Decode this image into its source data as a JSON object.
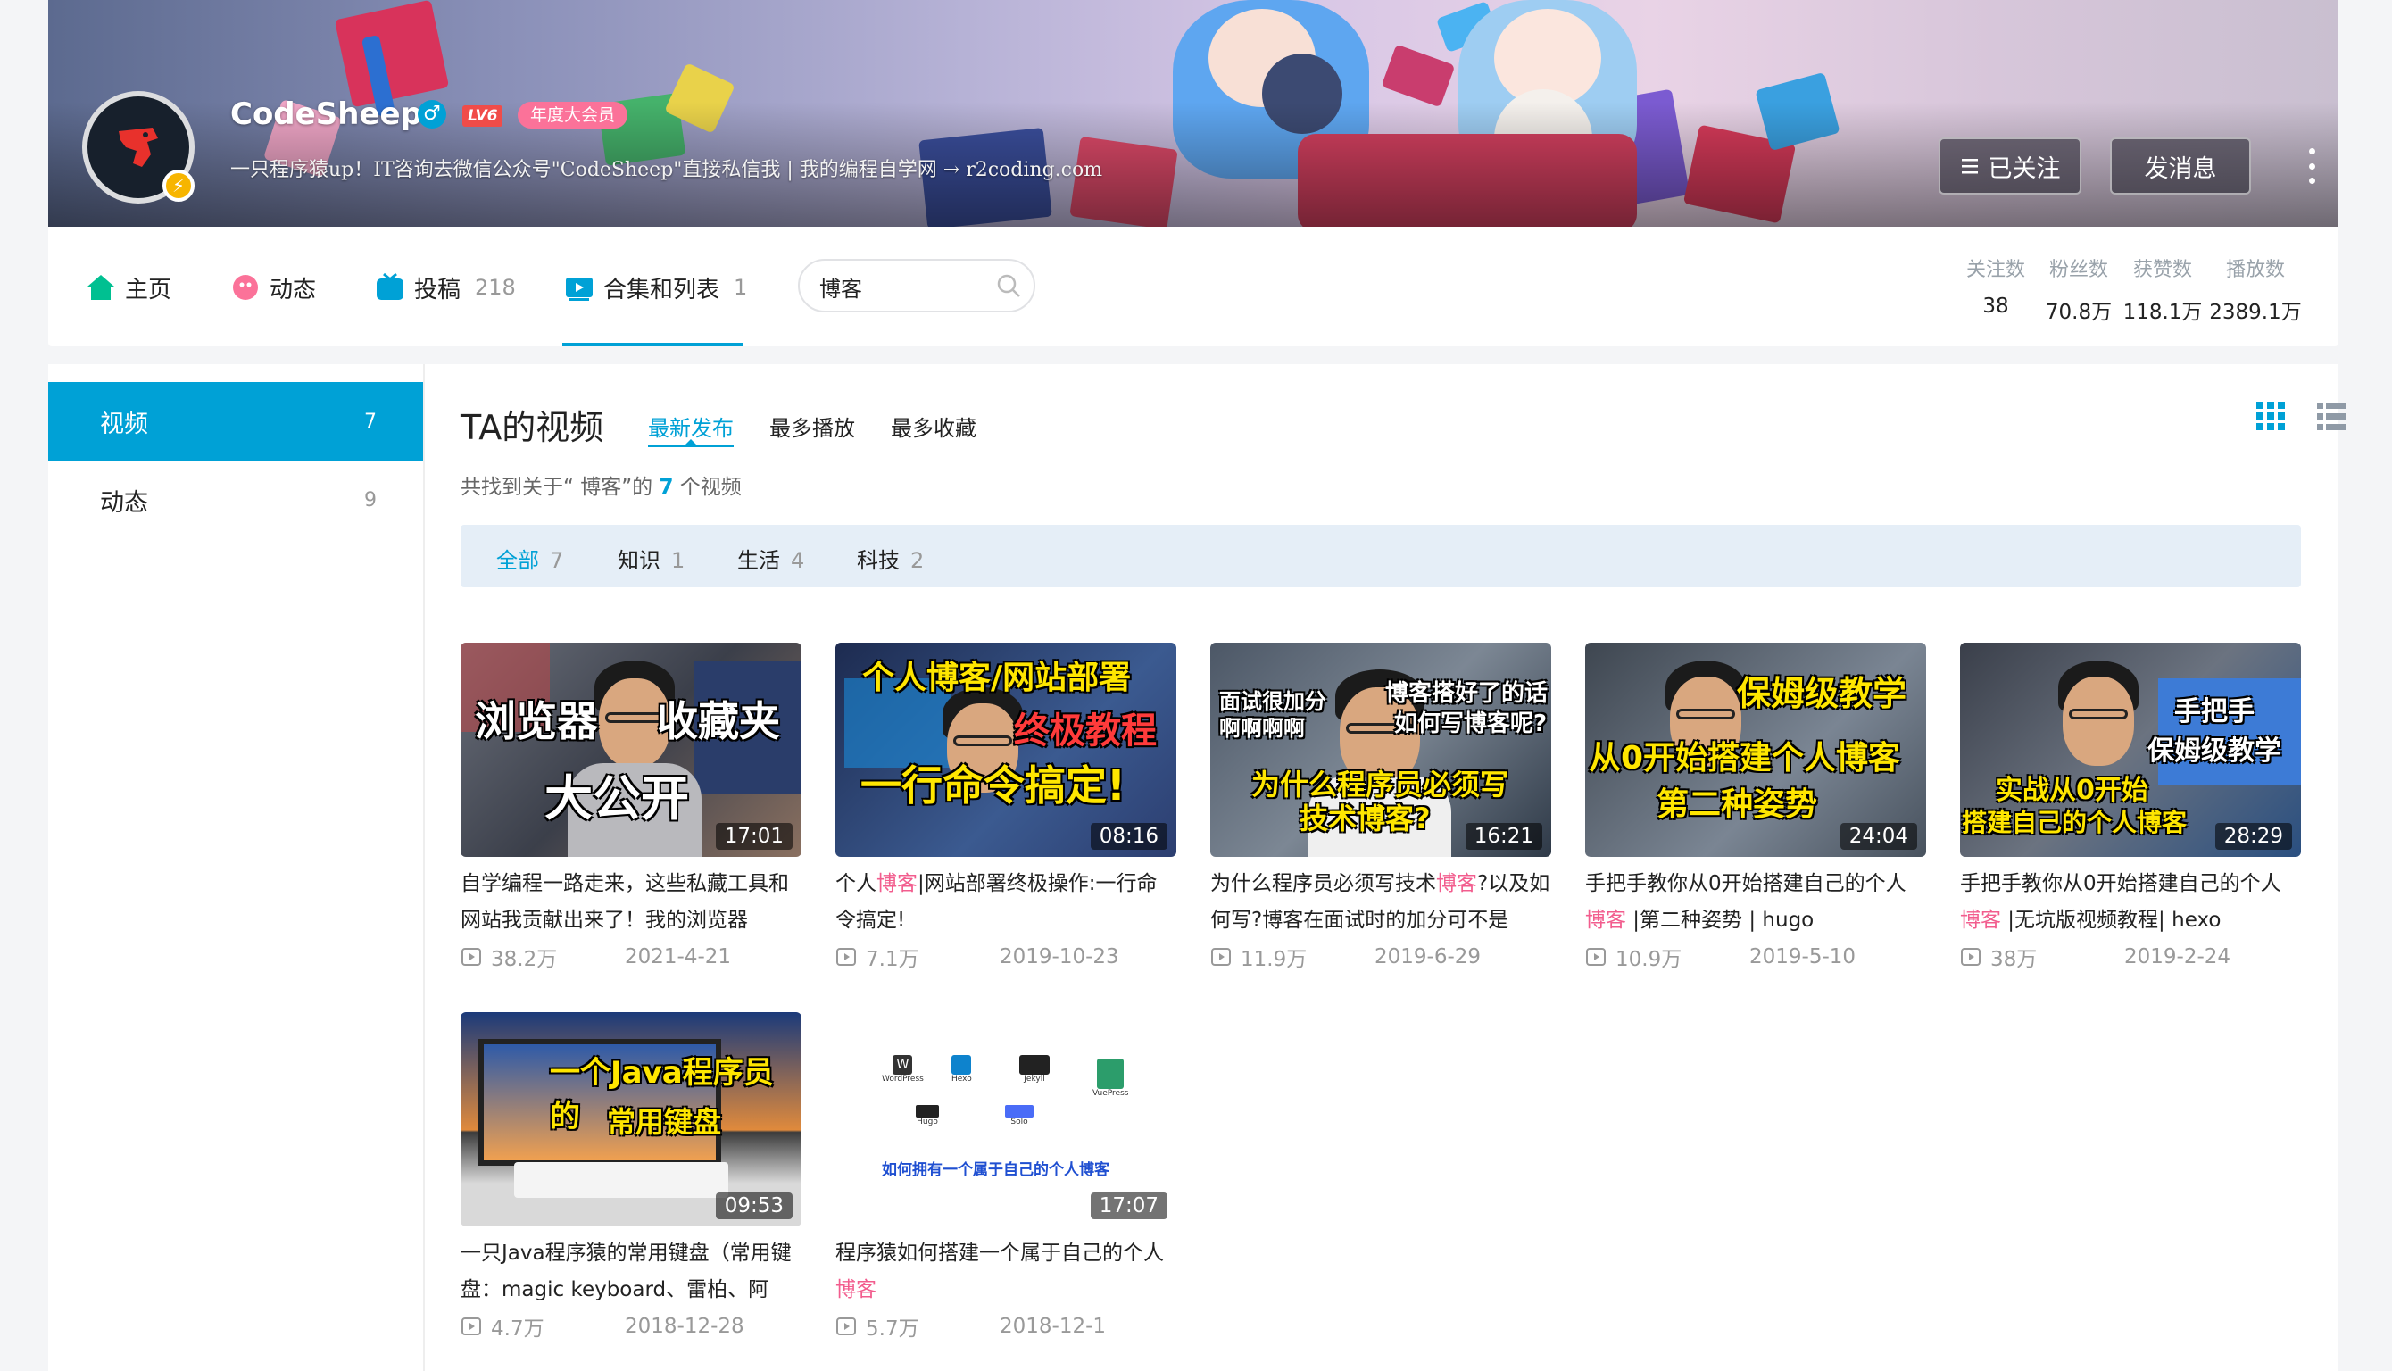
{
  "profile": {
    "name": "CodeSheep",
    "level": "LV6",
    "vip_label": "年度大会员",
    "sign": "一只程序猿up！IT咨询去微信公众号\"CodeSheep\"直接私信我 | 我的编程自学网 → r2coding.com",
    "follow_button": "已关注",
    "message_button": "发消息"
  },
  "nav": {
    "items": [
      {
        "label": "主页",
        "count": ""
      },
      {
        "label": "动态",
        "count": ""
      },
      {
        "label": "投稿",
        "count": "218"
      },
      {
        "label": "合集和列表",
        "count": "1"
      }
    ],
    "search_value": "博客"
  },
  "stats": [
    {
      "label": "关注数",
      "value": "38"
    },
    {
      "label": "粉丝数",
      "value": "70.8万"
    },
    {
      "label": "获赞数",
      "value": "118.1万"
    },
    {
      "label": "播放数",
      "value": "2389.1万"
    }
  ],
  "sidebar": {
    "items": [
      {
        "label": "视频",
        "count": "7"
      },
      {
        "label": "动态",
        "count": "9"
      }
    ]
  },
  "main": {
    "title": "TA的视频",
    "sort_tabs": [
      "最新发布",
      "最多播放",
      "最多收藏"
    ],
    "found_prefix": "共找到关于“ 博客”的",
    "found_count": "7",
    "found_suffix": "个视频",
    "categories": [
      {
        "label": "全部",
        "count": "7"
      },
      {
        "label": "知识",
        "count": "1"
      },
      {
        "label": "生活",
        "count": "4"
      },
      {
        "label": "科技",
        "count": "2"
      }
    ]
  },
  "videos": [
    {
      "title_before": "自学编程一路走来，这些私藏工具和网站我贡献出来了！我的浏览器",
      "keyword": "",
      "title_after": "",
      "duration": "17:01",
      "plays": "38.2万",
      "date": "2021-4-21",
      "thumb_lines": [
        "浏览器",
        "收藏夹",
        "大公开"
      ]
    },
    {
      "title_before": "个人",
      "keyword": "博客",
      "title_after": "|网站部署终极操作:一行命令搞定!",
      "duration": "08:16",
      "plays": "7.1万",
      "date": "2019-10-23",
      "thumb_lines": [
        "个人博客/网站部署",
        "终极教程",
        "一行命令搞定!"
      ]
    },
    {
      "title_before": "为什么程序员必须写技术",
      "keyword": "博客",
      "title_after": "?以及如何写?博客在面试时的加分可不是",
      "duration": "16:21",
      "plays": "11.9万",
      "date": "2019-6-29",
      "thumb_lines": [
        "面试很加分",
        "啊啊啊啊",
        "博客搭好了的话",
        "如何写博客呢?",
        "为什么程序员必须写",
        "技术博客?"
      ]
    },
    {
      "title_before": "手把手教你从0开始搭建自己的个人",
      "keyword": "博客",
      "title_after": " |第二种姿势 | hugo",
      "duration": "24:04",
      "plays": "10.9万",
      "date": "2019-5-10",
      "thumb_lines": [
        "保姆级教学",
        "从0开始搭建个人博客",
        "第二种姿势"
      ]
    },
    {
      "title_before": "手把手教你从0开始搭建自己的个人",
      "keyword": "博客",
      "title_after": " |无坑版视频教程| hexo",
      "duration": "28:29",
      "plays": "38万",
      "date": "2019-2-24",
      "thumb_lines": [
        "手把手",
        "保姆级教学",
        "实战从0开始",
        "搭建自己的个人博客"
      ]
    },
    {
      "title_before": "一只Java程序猿的常用键盘（常用键盘：magic keyboard、雷柏、阿",
      "keyword": "",
      "title_after": "",
      "duration": "09:53",
      "plays": "4.7万",
      "date": "2018-12-28",
      "thumb_lines": [
        "一个Java程序员的",
        "常用键盘"
      ]
    },
    {
      "title_before": "程序猿如何搭建一个属于自己的个人",
      "keyword": "博客",
      "title_after": "",
      "duration": "17:07",
      "plays": "5.7万",
      "date": "2018-12-1",
      "thumb_lines": [
        "如何拥有一个属于自己的个人博客"
      ],
      "thumb_icons": [
        "WordPress",
        "Hexo",
        "Jekyll",
        "VuePress",
        "Hugo",
        "Solo"
      ]
    }
  ],
  "colors": {
    "accent": "#00a1d6",
    "keyword": "#f25d8e",
    "vip": "#fb7299"
  }
}
